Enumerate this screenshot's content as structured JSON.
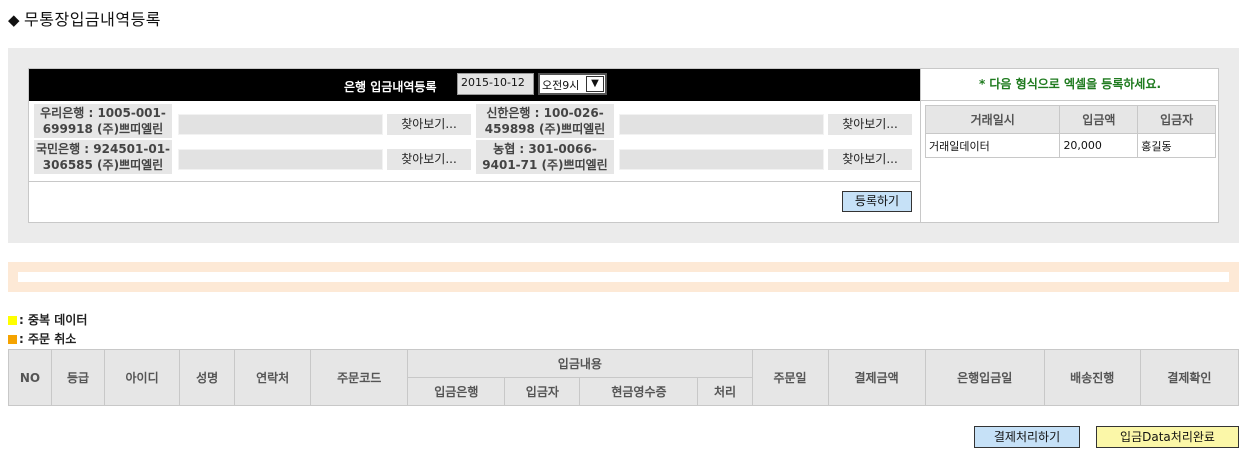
{
  "title": "무통장입금내역등록",
  "upload": {
    "header_label": "은행 입금내역등록",
    "date_value": "2015-10-12",
    "time_value": "오전9시",
    "banks": [
      {
        "label_line1": "우리은행 : 1005-001-",
        "label_line2": "699918 (주)쁘띠엘린",
        "button": "찾아보기..."
      },
      {
        "label_line1": "신한은행 : 100-026-",
        "label_line2": "459898 (주)쁘띠엘린",
        "button": "찾아보기..."
      },
      {
        "label_line1": "국민은행 : 924501-01-",
        "label_line2": "306585 (주)쁘띠엘린",
        "button": "찾아보기..."
      },
      {
        "label_line1": "농협 : 301-0066-",
        "label_line2": "9401-71 (주)쁘띠엘린",
        "button": "찾아보기..."
      }
    ],
    "register_label": "등록하기"
  },
  "format_hint": {
    "text": "* 다음 형식으로 엑셀을 등록하세요.",
    "headers": [
      "거래일시",
      "입금액",
      "입금자"
    ],
    "row": [
      "거래일데이터",
      "20,000",
      "홍길동"
    ]
  },
  "legend": {
    "duplicate": ": 중복 데이터",
    "cancel": ": 주문 취소",
    "duplicate_color": "#ffff00",
    "cancel_color": "#f5a300"
  },
  "order_table": {
    "no": "NO",
    "grade": "등급",
    "id": "아이디",
    "name": "성명",
    "contact": "연락처",
    "order_code": "주문코드",
    "deposit_group": "입금내용",
    "deposit_bank": "입금은행",
    "depositor": "입금자",
    "cash_receipt": "현금영수증",
    "process": "처리",
    "order_date": "주문일",
    "pay_amount": "결제금액",
    "bank_deposit_date": "은행입금일",
    "shipping": "배송진행",
    "pay_confirm": "결제확인"
  },
  "actions": {
    "pay_process": "결제처리하기",
    "data_done": "입금Data처리완료"
  }
}
